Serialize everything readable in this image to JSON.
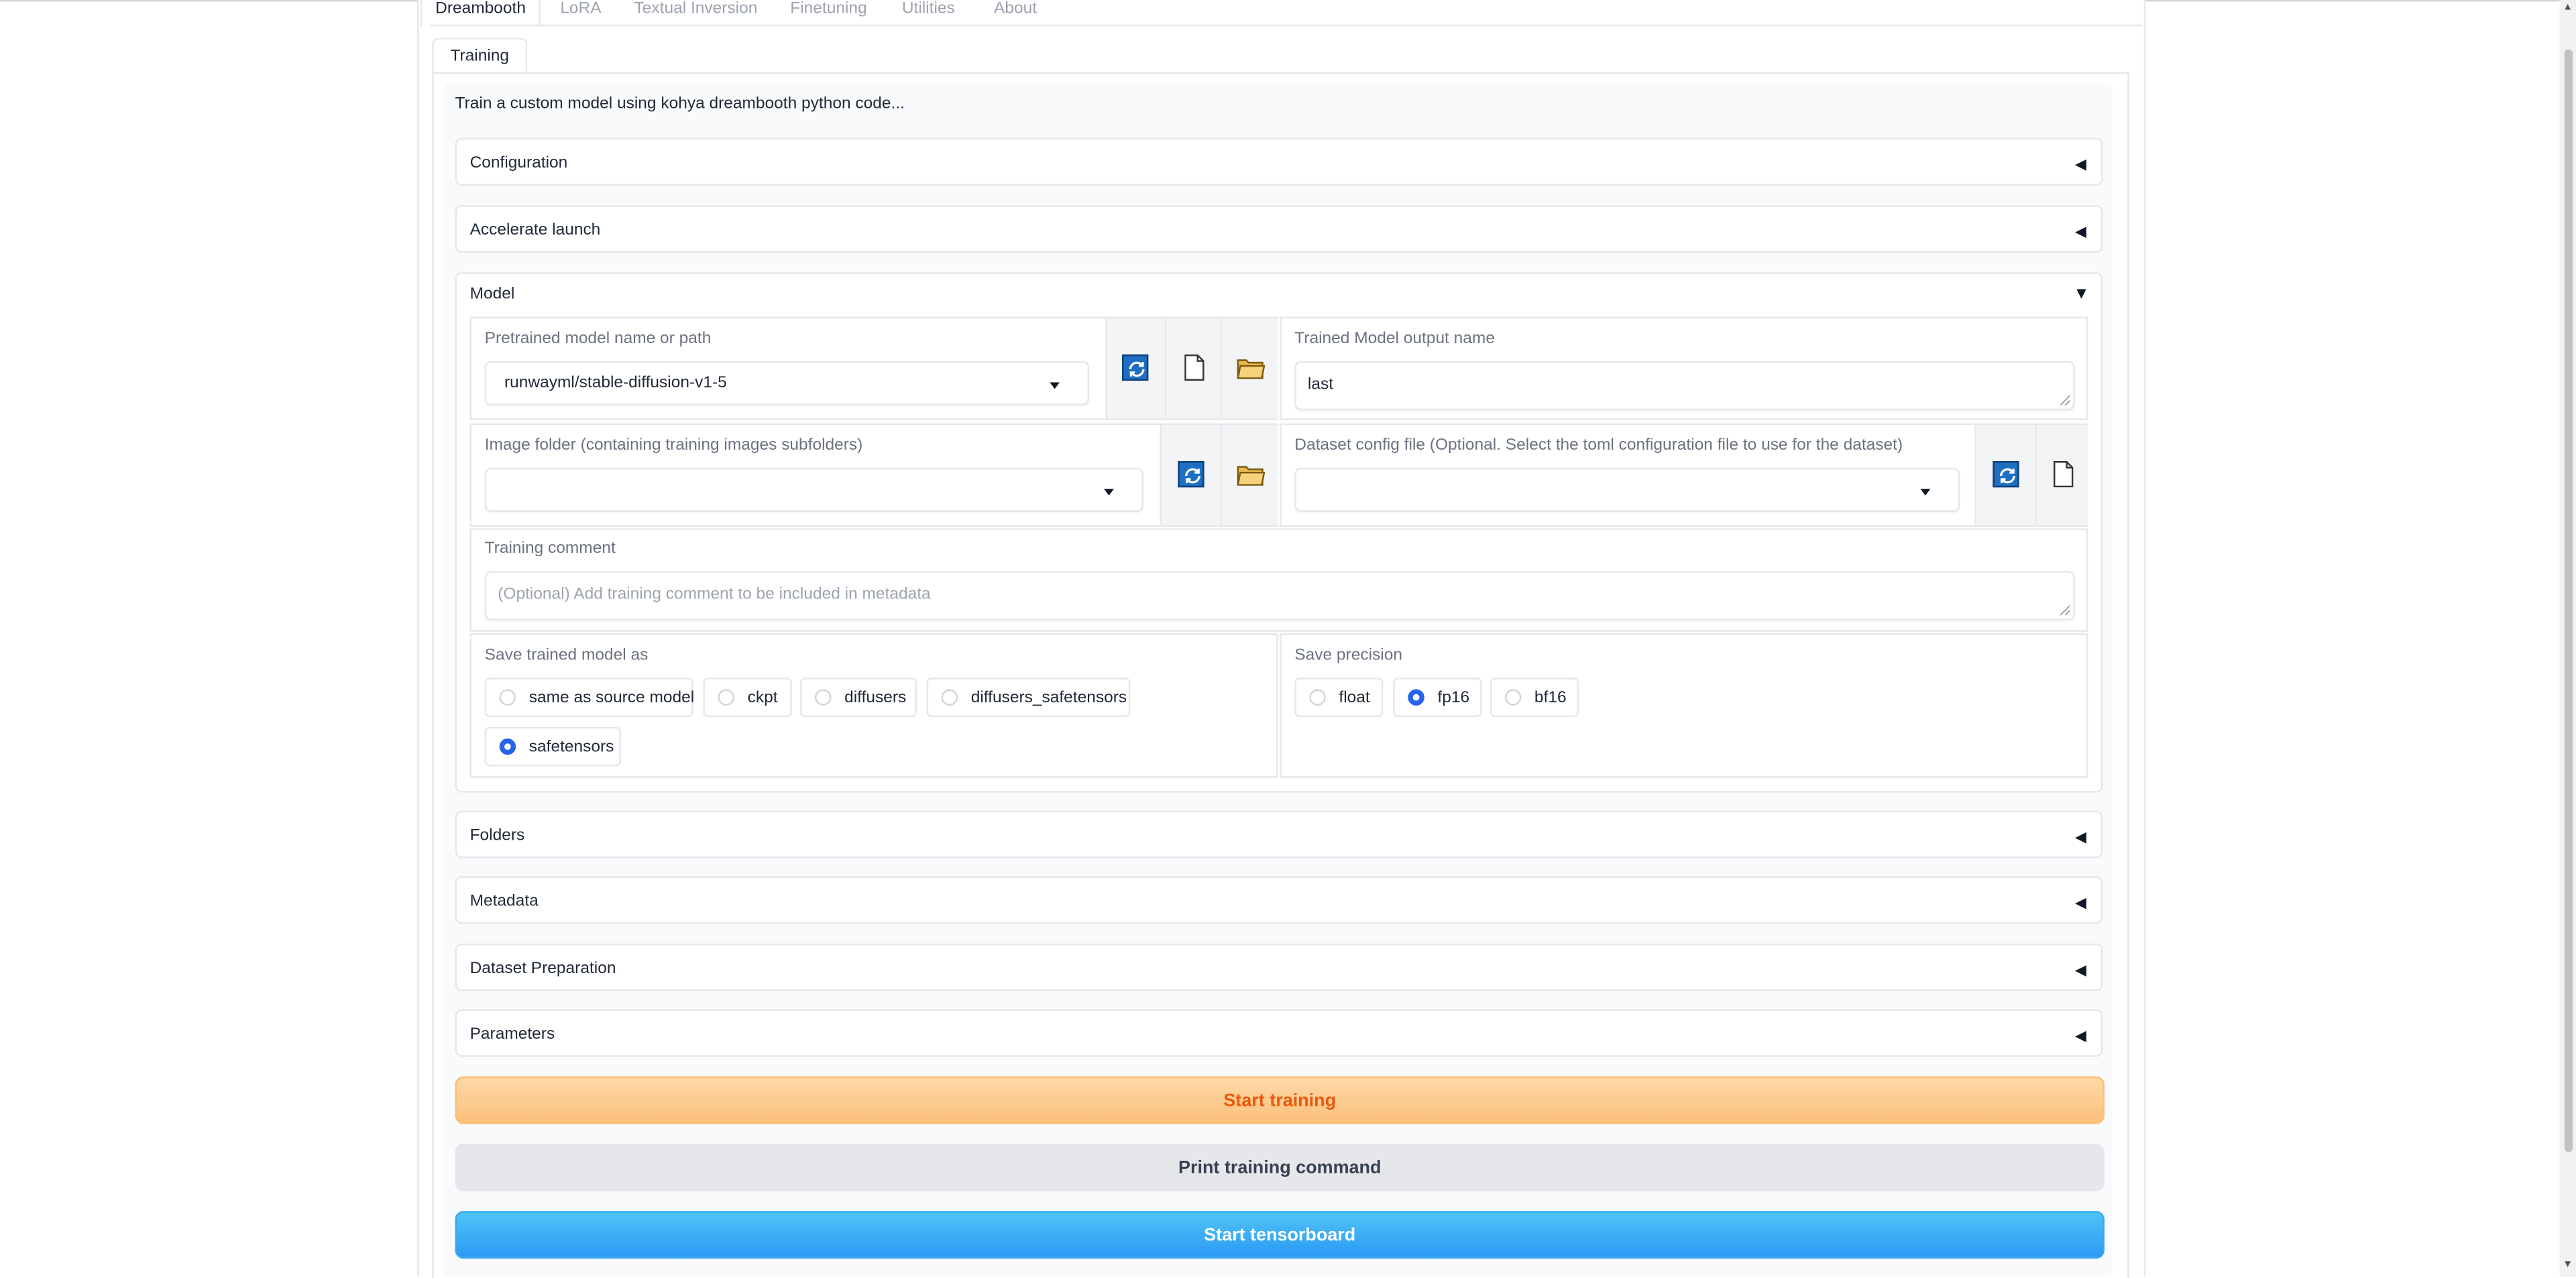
{
  "tabs": [
    "Dreambooth",
    "LoRA",
    "Textual Inversion",
    "Finetuning",
    "Utilities",
    "About"
  ],
  "active_tab": "Dreambooth",
  "subtab": "Training",
  "description": "Train a custom model using kohya dreambooth python code...",
  "accordions": {
    "configuration": "Configuration",
    "accelerate": "Accelerate launch",
    "model": "Model",
    "folders": "Folders",
    "metadata": "Metadata",
    "dataset_prep": "Dataset Preparation",
    "parameters": "Parameters"
  },
  "arrows": {
    "collapsed": "◀",
    "expanded": "▼"
  },
  "model": {
    "pretrained_label": "Pretrained model name or path",
    "pretrained_value": "runwayml/stable-diffusion-v1-5",
    "output_name_label": "Trained Model output name",
    "output_name_value": "last",
    "image_folder_label": "Image folder (containing training images subfolders)",
    "image_folder_value": "",
    "dataset_config_label": "Dataset config file (Optional. Select the toml configuration file to use for the dataset)",
    "dataset_config_value": "",
    "comment_label": "Training comment",
    "comment_placeholder": "(Optional) Add training comment to be included in metadata",
    "save_as_label": "Save trained model as",
    "save_as_options": [
      "same as source model",
      "ckpt",
      "diffusers",
      "diffusers_safetensors",
      "safetensors"
    ],
    "save_as_selected": "safetensors",
    "precision_label": "Save precision",
    "precision_options": [
      "float",
      "fp16",
      "bf16"
    ],
    "precision_selected": "fp16"
  },
  "buttons": {
    "start_training": "Start training",
    "print_command": "Print training command",
    "start_tensorboard": "Start tensorboard"
  },
  "icons": {
    "refresh": "refresh-icon",
    "document": "document-icon",
    "folder": "folder-icon"
  },
  "colors": {
    "refresh_blue": "#1e6fc2",
    "train_orange": "#ea580c",
    "tensorboard_blue": "#2b9af3",
    "radio_selected": "#2563eb"
  }
}
